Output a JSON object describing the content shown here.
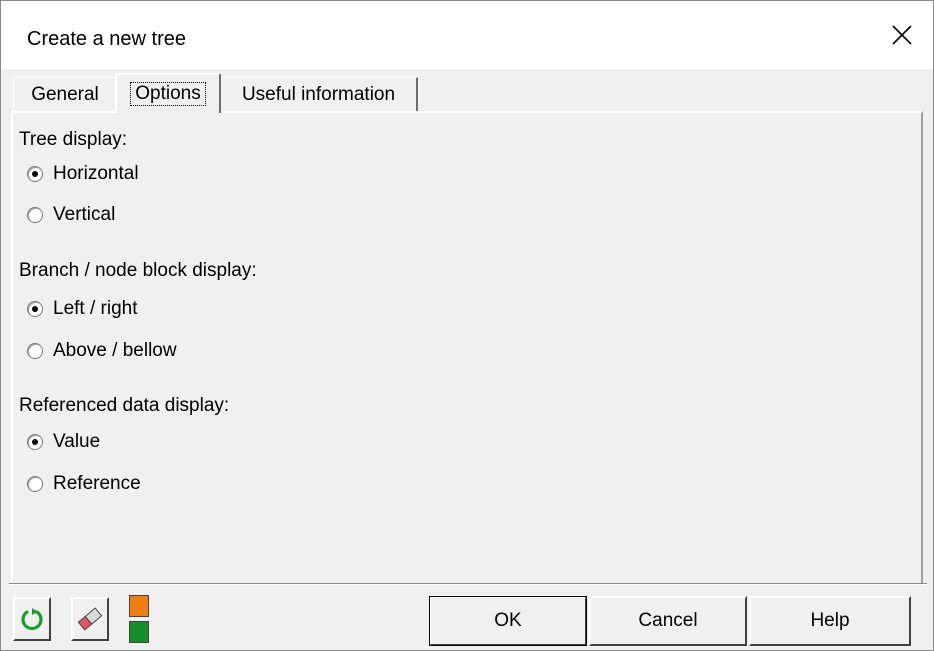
{
  "window": {
    "title": "Create a new tree",
    "close_icon": "close-icon"
  },
  "tabs": [
    {
      "label": "General",
      "active": false
    },
    {
      "label": "Options",
      "active": true
    },
    {
      "label": "Useful information",
      "active": false
    }
  ],
  "options": {
    "tree_display": {
      "label": "Tree display:",
      "choices": [
        {
          "label": "Horizontal",
          "selected": true
        },
        {
          "label": "Vertical",
          "selected": false
        }
      ]
    },
    "branch_node_display": {
      "label": "Branch / node block display:",
      "choices": [
        {
          "label": "Left / right",
          "selected": true
        },
        {
          "label": "Above / bellow",
          "selected": false
        }
      ]
    },
    "referenced_data_display": {
      "label": "Referenced data display:",
      "choices": [
        {
          "label": "Value",
          "selected": true
        },
        {
          "label": "Reference",
          "selected": false
        }
      ]
    }
  },
  "toolbar": {
    "refresh_icon": "refresh-icon",
    "eraser_icon": "eraser-icon",
    "swatch_colors": {
      "top": "#f07d12",
      "bottom": "#148f2c"
    }
  },
  "buttons": {
    "ok": "OK",
    "cancel": "Cancel",
    "help": "Help"
  }
}
